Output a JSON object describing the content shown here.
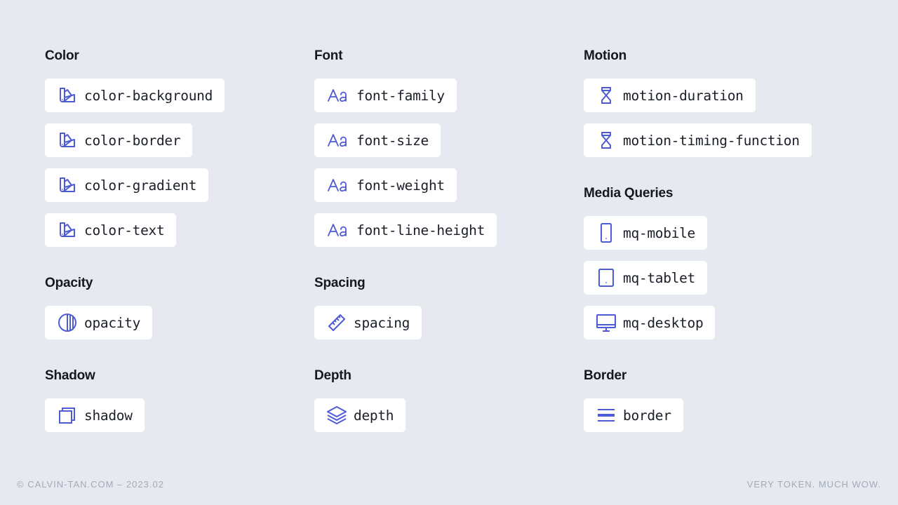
{
  "accent_color": "#4f5bd5",
  "columns": [
    {
      "sections": [
        {
          "title": "Color",
          "tokens": [
            {
              "label": "color-background",
              "icon": "swatch-icon"
            },
            {
              "label": "color-border",
              "icon": "swatch-icon"
            },
            {
              "label": "color-gradient",
              "icon": "swatch-icon"
            },
            {
              "label": "color-text",
              "icon": "swatch-icon"
            }
          ]
        },
        {
          "title": "Opacity",
          "tokens": [
            {
              "label": "opacity",
              "icon": "opacity-icon"
            }
          ]
        },
        {
          "title": "Shadow",
          "tokens": [
            {
              "label": "shadow",
              "icon": "shadow-icon"
            }
          ]
        }
      ]
    },
    {
      "sections": [
        {
          "title": "Font",
          "tokens": [
            {
              "label": "font-family",
              "icon": "typography-icon"
            },
            {
              "label": "font-size",
              "icon": "typography-icon"
            },
            {
              "label": "font-weight",
              "icon": "typography-icon"
            },
            {
              "label": "font-line-height",
              "icon": "typography-icon"
            }
          ]
        },
        {
          "title": "Spacing",
          "tokens": [
            {
              "label": "spacing",
              "icon": "ruler-icon"
            }
          ]
        },
        {
          "title": "Depth",
          "tokens": [
            {
              "label": "depth",
              "icon": "layers-icon"
            }
          ]
        }
      ]
    },
    {
      "sections": [
        {
          "title": "Motion",
          "tokens": [
            {
              "label": "motion-duration",
              "icon": "hourglass-icon"
            },
            {
              "label": "motion-timing-function",
              "icon": "hourglass-icon"
            }
          ]
        },
        {
          "title": "Media Queries",
          "tokens": [
            {
              "label": "mq-mobile",
              "icon": "mobile-icon"
            },
            {
              "label": "mq-tablet",
              "icon": "tablet-icon"
            },
            {
              "label": "mq-desktop",
              "icon": "desktop-icon"
            }
          ]
        },
        {
          "title": "Border",
          "tokens": [
            {
              "label": "border",
              "icon": "border-lines-icon"
            }
          ]
        }
      ]
    }
  ],
  "footer": {
    "left": "© CALVIN-TAN.COM – 2023.02",
    "right": "VERY TOKEN. MUCH WOW."
  }
}
